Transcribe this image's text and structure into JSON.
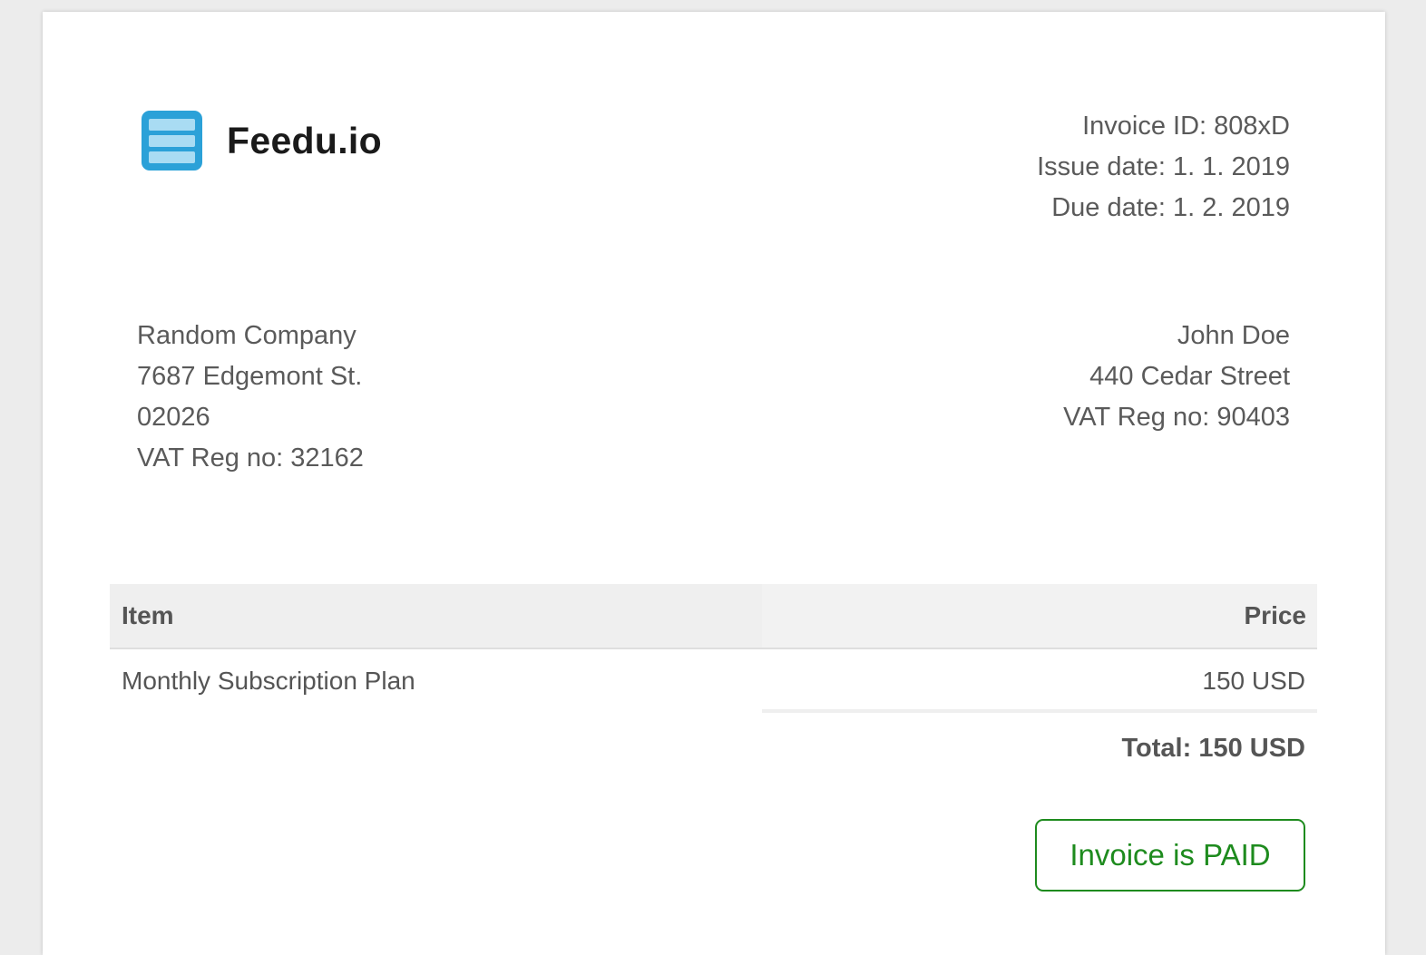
{
  "brand": {
    "name": "Feedu.io",
    "icon": "stacked-list-icon",
    "icon_color": "#2ba1d8"
  },
  "invoice_meta": {
    "invoice_id": "Invoice ID: 808xD",
    "issue_date": "Issue date: 1. 1. 2019",
    "due_date": "Due date: 1. 2. 2019"
  },
  "seller": {
    "name": "Random Company",
    "street": "7687 Edgemont St.",
    "zip": "02026",
    "vat": "VAT Reg no: 32162"
  },
  "buyer": {
    "name": "John Doe",
    "street": "440 Cedar Street",
    "vat": "VAT Reg no: 90403"
  },
  "items": {
    "headers": [
      "Item",
      "Price"
    ],
    "rows": [
      {
        "item": "Monthly Subscription Plan",
        "price": "150 USD"
      }
    ]
  },
  "total": "Total: 150 USD",
  "status": {
    "label": "Invoice is PAID",
    "color": "#1e8b1e"
  }
}
